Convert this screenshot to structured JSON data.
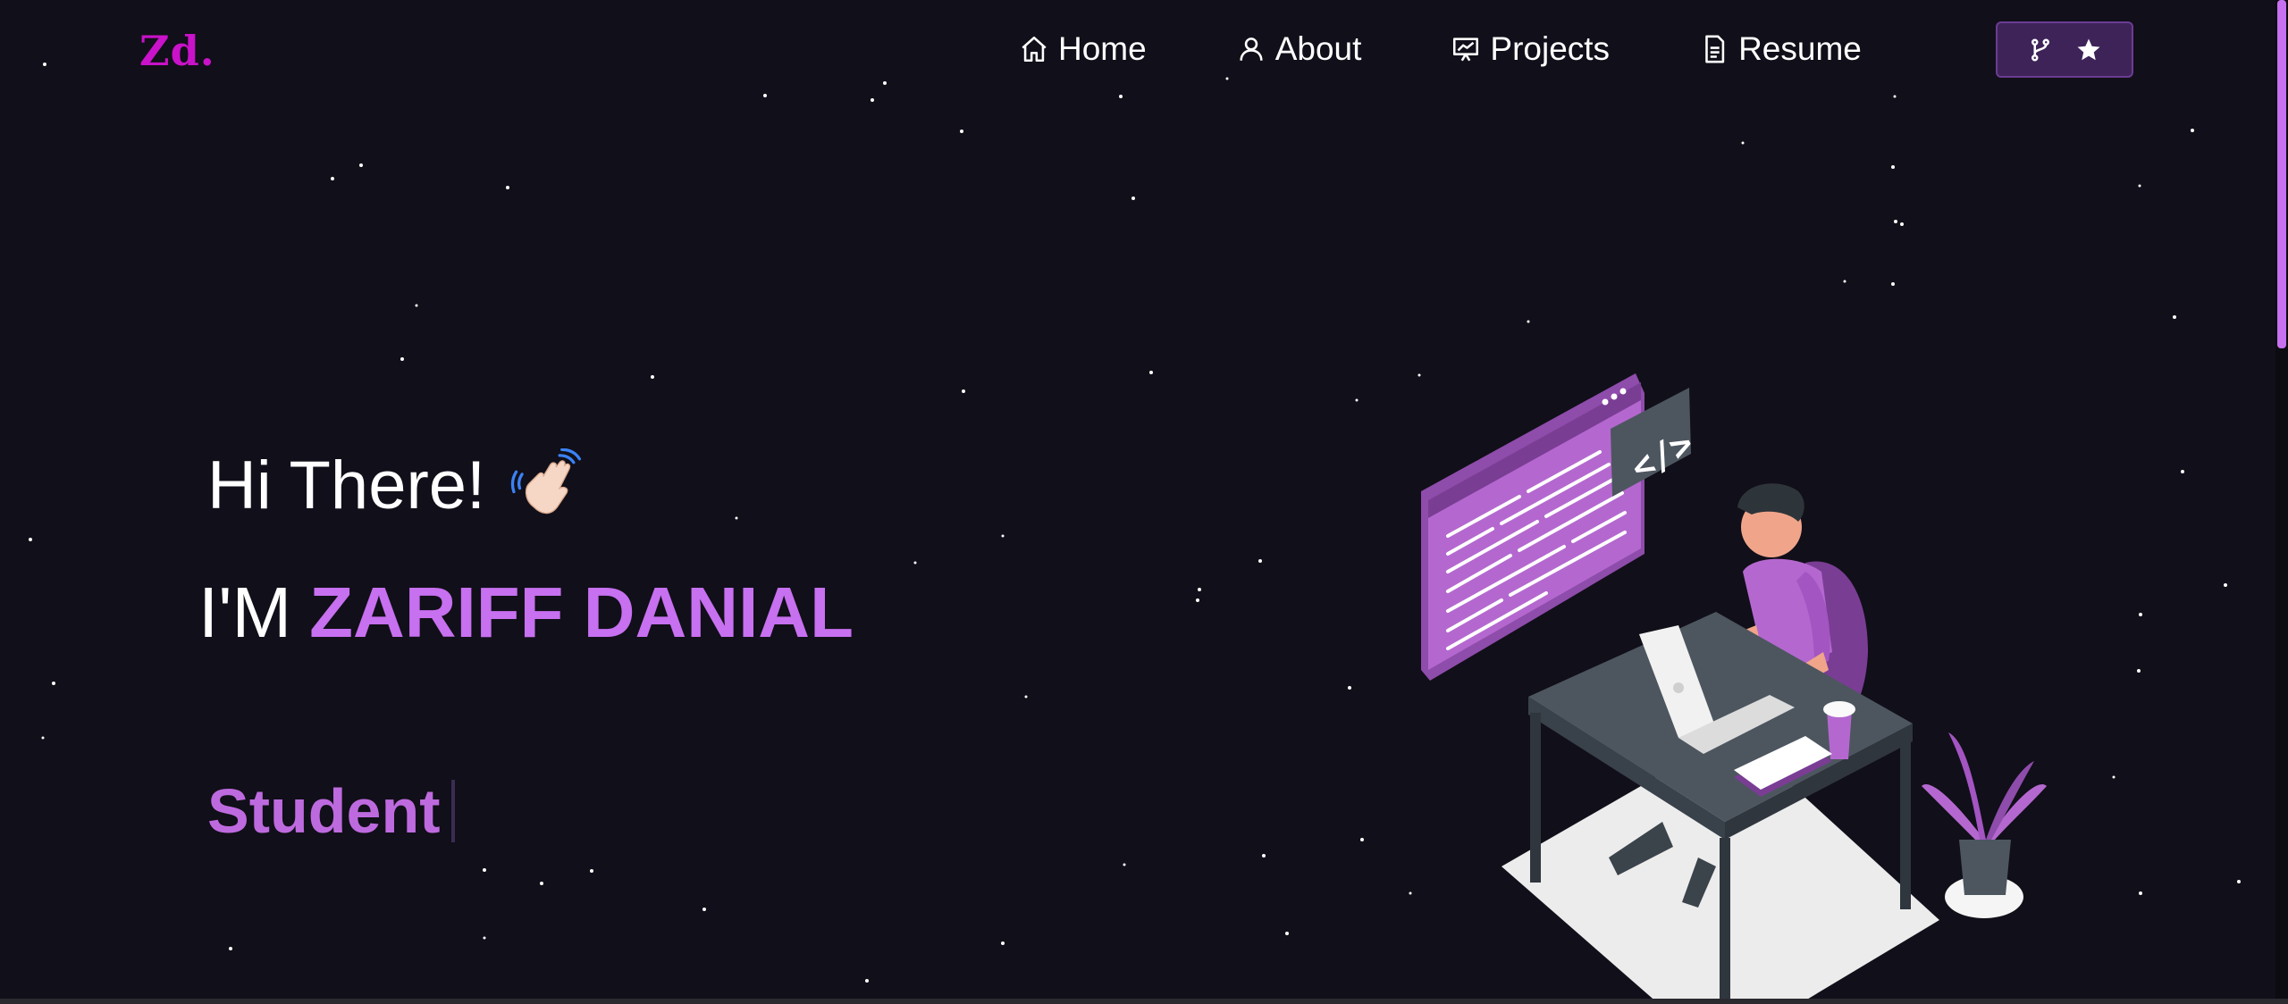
{
  "brand": {
    "logo_text": "Zd."
  },
  "nav": {
    "items": [
      {
        "label": "Home",
        "icon": "home-icon"
      },
      {
        "label": "About",
        "icon": "user-icon"
      },
      {
        "label": "Projects",
        "icon": "presentation-icon"
      },
      {
        "label": "Resume",
        "icon": "document-icon"
      }
    ],
    "github_button": {
      "icons": [
        "git-fork-icon",
        "star-icon"
      ]
    }
  },
  "hero": {
    "greeting": "Hi There!",
    "greeting_icon": "waving-hand-icon",
    "intro": "I'M",
    "name": "ZARIFF DANIAL",
    "role": "Student"
  },
  "colors": {
    "background": "#110f19",
    "accent": "#c770f0",
    "logo": "#c912c9",
    "button_bg": "#3e2359"
  }
}
